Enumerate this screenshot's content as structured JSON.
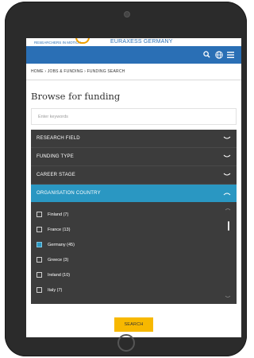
{
  "brand": {
    "tagline": "RESEARCHERS IN MOTION",
    "name": "EURAXESS GERMANY"
  },
  "header": {
    "icons": [
      "search-icon",
      "globe-icon",
      "menu-icon"
    ]
  },
  "breadcrumb": "HOME › JOBS & FUNDING › FUNDING SEARCH",
  "page_title": "Browse for funding",
  "search": {
    "placeholder": "Enter keywords",
    "value": ""
  },
  "filters": [
    {
      "label": "RESEARCH FIELD",
      "expanded": false
    },
    {
      "label": "FUNDING TYPE",
      "expanded": false
    },
    {
      "label": "CAREER STAGE",
      "expanded": false
    },
    {
      "label": "ORGANISATION COUNTRY",
      "expanded": true
    }
  ],
  "country_options": [
    {
      "label": "Finland (7)",
      "checked": false
    },
    {
      "label": "France (13)",
      "checked": false
    },
    {
      "label": "Germany (45)",
      "checked": true
    },
    {
      "label": "Greece (3)",
      "checked": false
    },
    {
      "label": "Ireland (10)",
      "checked": false
    },
    {
      "label": "Italy (7)",
      "checked": false
    }
  ],
  "search_button": "SEARCH",
  "colors": {
    "primary": "#2a6fb5",
    "accent_active": "#2a97c2",
    "filter_bg": "#3c3c3c",
    "button": "#f7b800"
  }
}
